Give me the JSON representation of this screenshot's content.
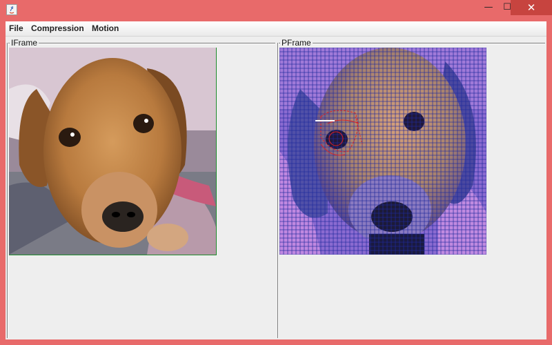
{
  "window": {
    "min_glyph": "—",
    "max_glyph": "☐",
    "close_glyph": "✕"
  },
  "menu": {
    "file": "File",
    "compression": "Compression",
    "motion": "Motion"
  },
  "panels": {
    "iframe_title": "IFrame",
    "pframe_title": "PFrame"
  },
  "icons": {
    "app": "java-app-icon",
    "minimize": "minimize-icon",
    "maximize": "maximize-icon",
    "close": "close-icon"
  },
  "colors": {
    "titlebar": "#e86a6a",
    "close_button": "#c7443f",
    "grid": "#1f2a9c",
    "motion_vectors": "#e02020"
  }
}
